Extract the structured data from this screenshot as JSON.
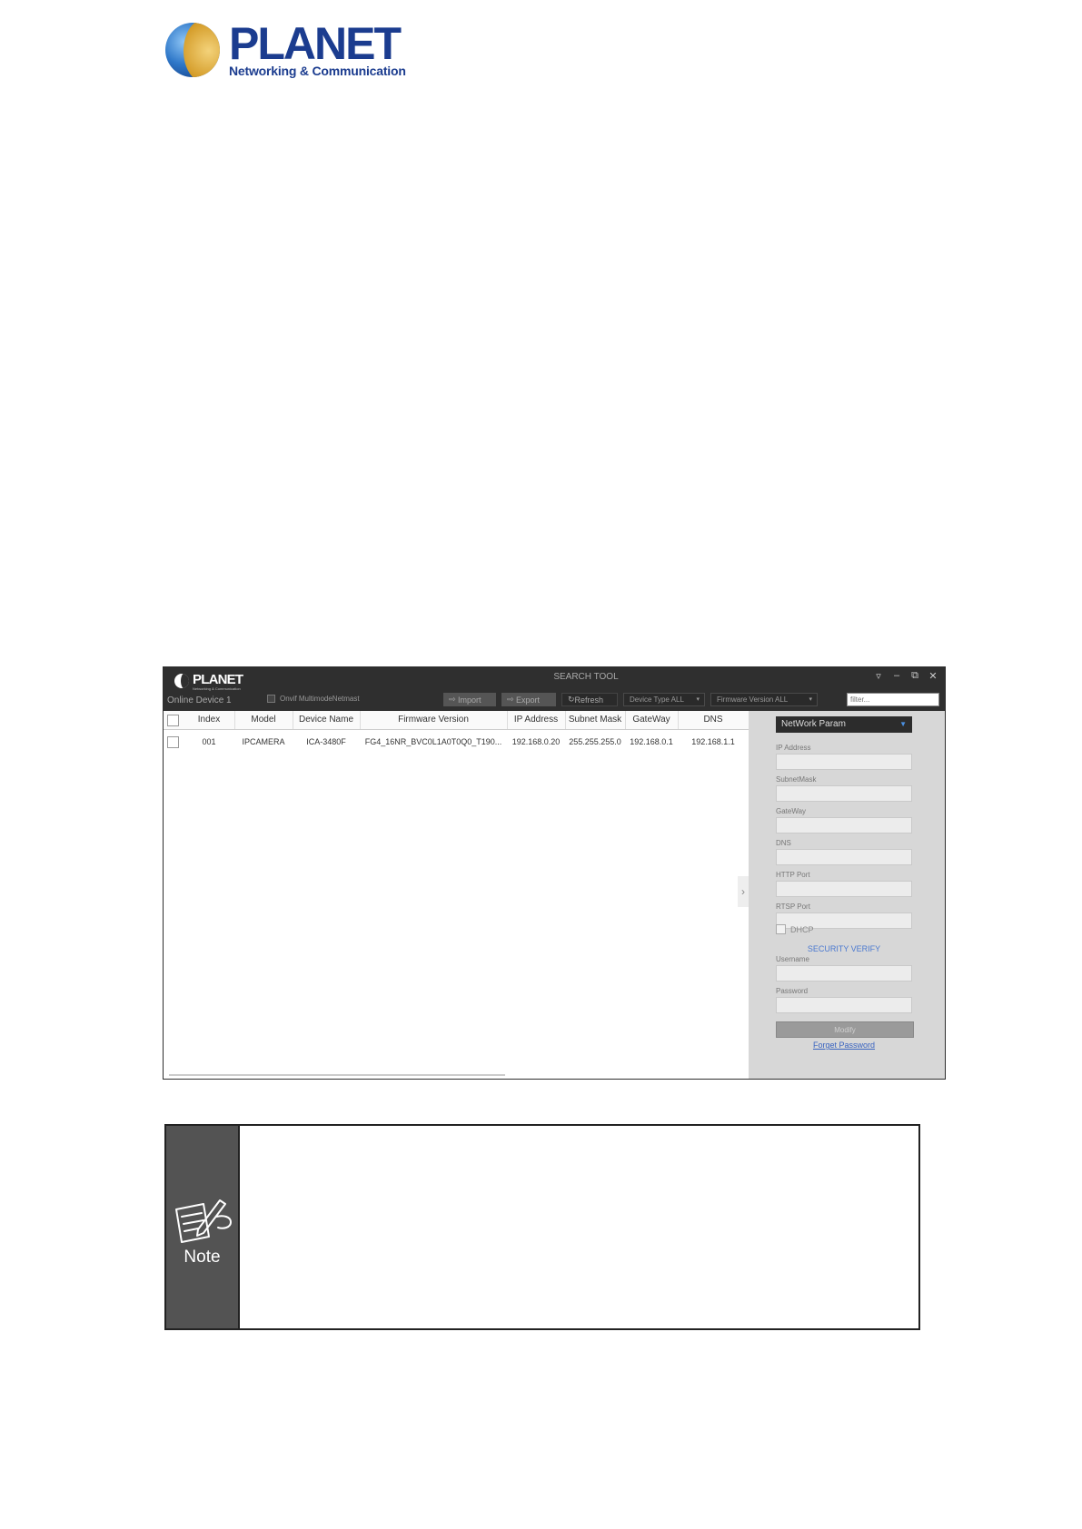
{
  "logo": {
    "word": "PLANET",
    "tagline": "Networking & Communication"
  },
  "app": {
    "logo_word": "PLANET",
    "logo_sub": "Networking & Communication",
    "title": "SEARCH TOOL",
    "window_controls": [
      "▿",
      "–",
      "⧉",
      "✕"
    ],
    "online_device": "Online Device 1",
    "onvif_label": "Onvif MultimodeNetmast",
    "import_label": "Import",
    "export_label": "Export",
    "refresh_label": "Refresh",
    "device_type": "Device Type ALL",
    "firmware_version": "Firmware Version ALL",
    "filter_placeholder": "filter..."
  },
  "table": {
    "headers": [
      "Index",
      "Model",
      "Device Name",
      "Firmware Version",
      "IP Address",
      "Subnet Mask",
      "GateWay",
      "DNS"
    ],
    "rows": [
      [
        "001",
        "IPCAMERA",
        "ICA-3480F",
        "FG4_16NR_BVC0L1A0T0Q0_T190...",
        "192.168.0.20",
        "255.255.255.0",
        "192.168.0.1",
        "192.168.1.1"
      ]
    ]
  },
  "panel": {
    "select": "NetWork Param",
    "fields": [
      "IP Address",
      "SubnetMask",
      "GateWay",
      "DNS",
      "HTTP Port",
      "RTSP Port"
    ],
    "dhcp": "DHCP",
    "security": "SECURITY VERIFY",
    "username": "Username",
    "password": "Password",
    "modify": "Modify",
    "forgot": "Forget Password"
  },
  "note": {
    "label": "Note"
  }
}
